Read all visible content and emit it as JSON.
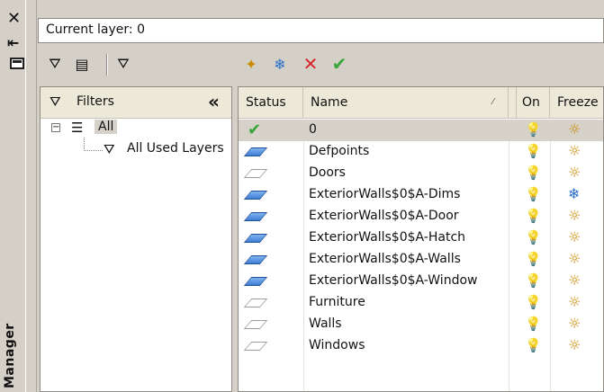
{
  "panel": {
    "vertical_title": "Manager",
    "current_layer_label": "Current layer: 0"
  },
  "toolbar": {
    "left_icons": [
      "filter-icon",
      "layer-states-icon",
      "filter-list-icon"
    ],
    "right_icons": [
      "new-layer-icon",
      "new-layer-vp-frozen-icon",
      "delete-layer-icon",
      "set-current-icon"
    ],
    "delete_color": "#d8262a",
    "check_color": "#3aa53a"
  },
  "filters": {
    "header": "Filters",
    "collapse_glyph": "«",
    "tree": [
      {
        "label": "All",
        "selected": true
      },
      {
        "label": "All Used Layers",
        "selected": false
      }
    ]
  },
  "grid": {
    "columns": {
      "status": "Status",
      "name": "Name",
      "on": "On",
      "freeze": "Freeze"
    },
    "rows": [
      {
        "status": "current",
        "name": "0",
        "on": "on",
        "freeze": "thawed",
        "selected": true
      },
      {
        "status": "in-use",
        "name": "Defpoints",
        "on": "on",
        "freeze": "thawed",
        "selected": false
      },
      {
        "status": "unused",
        "name": "Doors",
        "on": "on",
        "freeze": "thawed",
        "selected": false
      },
      {
        "status": "in-use",
        "name": "ExteriorWalls$0$A-Dims",
        "on": "on",
        "freeze": "frozen",
        "selected": false
      },
      {
        "status": "in-use",
        "name": "ExteriorWalls$0$A-Door",
        "on": "on",
        "freeze": "thawed",
        "selected": false
      },
      {
        "status": "in-use",
        "name": "ExteriorWalls$0$A-Hatch",
        "on": "on",
        "freeze": "thawed",
        "selected": false
      },
      {
        "status": "in-use",
        "name": "ExteriorWalls$0$A-Walls",
        "on": "on",
        "freeze": "thawed",
        "selected": false
      },
      {
        "status": "in-use",
        "name": "ExteriorWalls$0$A-Window",
        "on": "on",
        "freeze": "thawed",
        "selected": false
      },
      {
        "status": "unused",
        "name": "Furniture",
        "on": "on",
        "freeze": "thawed",
        "selected": false
      },
      {
        "status": "unused",
        "name": "Walls",
        "on": "on",
        "freeze": "thawed",
        "selected": false
      },
      {
        "status": "unused",
        "name": "Windows",
        "on": "on",
        "freeze": "thawed",
        "selected": false
      }
    ]
  }
}
